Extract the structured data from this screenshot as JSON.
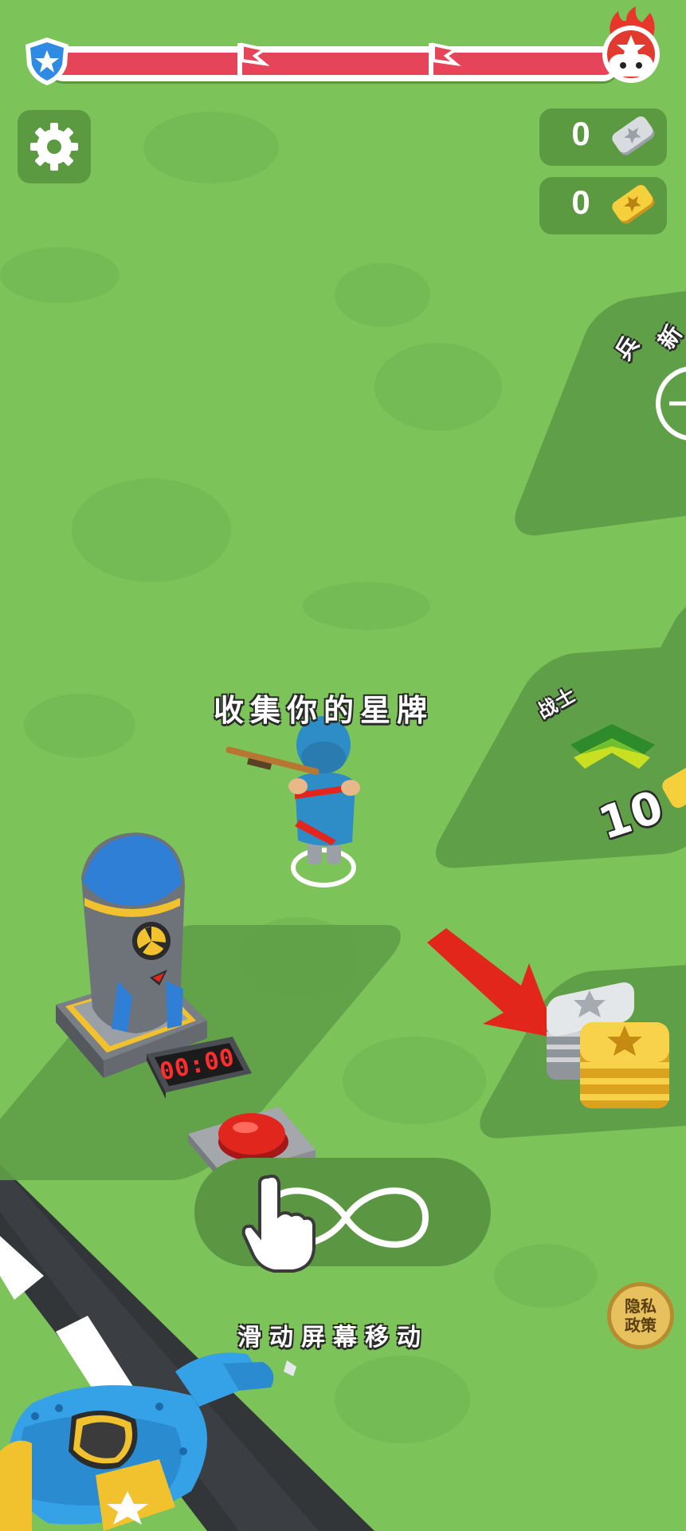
{
  "hud": {
    "level_progress": 0.0,
    "milestones": [
      "flag-icon",
      "flag-icon"
    ],
    "start_badge": "shield-star-icon",
    "end_badge": "enemy-boss-icon",
    "silver_count": "0",
    "gold_count": "0",
    "silver_icon": "silver-star-plate-icon",
    "gold_icon": "gold-star-plate-icon"
  },
  "settings": {
    "icon": "gear-icon"
  },
  "prompts": {
    "collect_stars": "收集你的星牌",
    "swipe_to_move": "滑动屏幕移动"
  },
  "zones": {
    "soldier_label": "战士",
    "soldier_cost": "10",
    "top_zone_label": "兵",
    "top_zone_partial": "新"
  },
  "bomb": {
    "timer": "00:00"
  },
  "privacy": {
    "line1": "隐私",
    "line2": "政策"
  },
  "colors": {
    "grass": "#7cc35a",
    "progress_red": "#e64559",
    "panel_green": "#5c9a42",
    "gold": "#f2c230",
    "arrow_red": "#e3261b"
  }
}
